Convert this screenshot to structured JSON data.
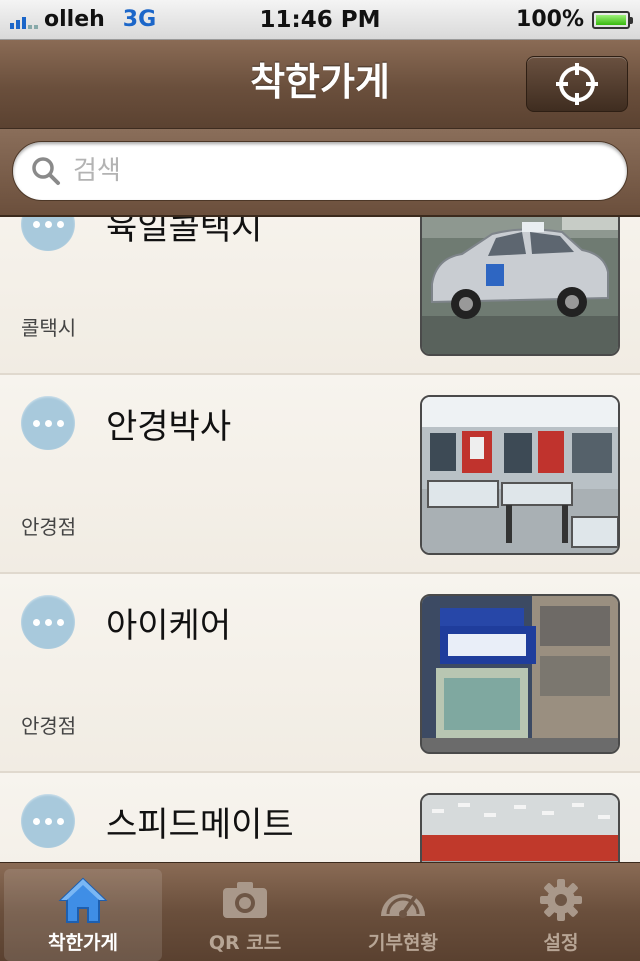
{
  "status_bar": {
    "carrier": "olleh",
    "network": "3G",
    "time": "11:46 PM",
    "battery": "100%",
    "battery_level": 1.0
  },
  "nav": {
    "title": "착한가게",
    "locate_icon": "crosshair-icon"
  },
  "search": {
    "placeholder": "검색",
    "value": ""
  },
  "stores": [
    {
      "name": "육일콜택시",
      "category": "콜택시",
      "thumb": "taxi"
    },
    {
      "name": "안경박사",
      "category": "안경점",
      "thumb": "optical-interior"
    },
    {
      "name": "아이케어",
      "category": "안경점",
      "thumb": "optical-storefront"
    },
    {
      "name": "스피드메이트",
      "category": "",
      "thumb": "garage"
    }
  ],
  "tabs": [
    {
      "label": "착한가게",
      "icon": "home-icon",
      "active": true
    },
    {
      "label": "QR 코드",
      "icon": "camera-icon",
      "active": false
    },
    {
      "label": "기부현황",
      "icon": "gauge-icon",
      "active": false
    },
    {
      "label": "설정",
      "icon": "gear-icon",
      "active": false
    }
  ],
  "colors": {
    "nav_brown": "#6a4f3c",
    "more_button": "#a8c9dc",
    "status_blue": "#1b66c9"
  }
}
